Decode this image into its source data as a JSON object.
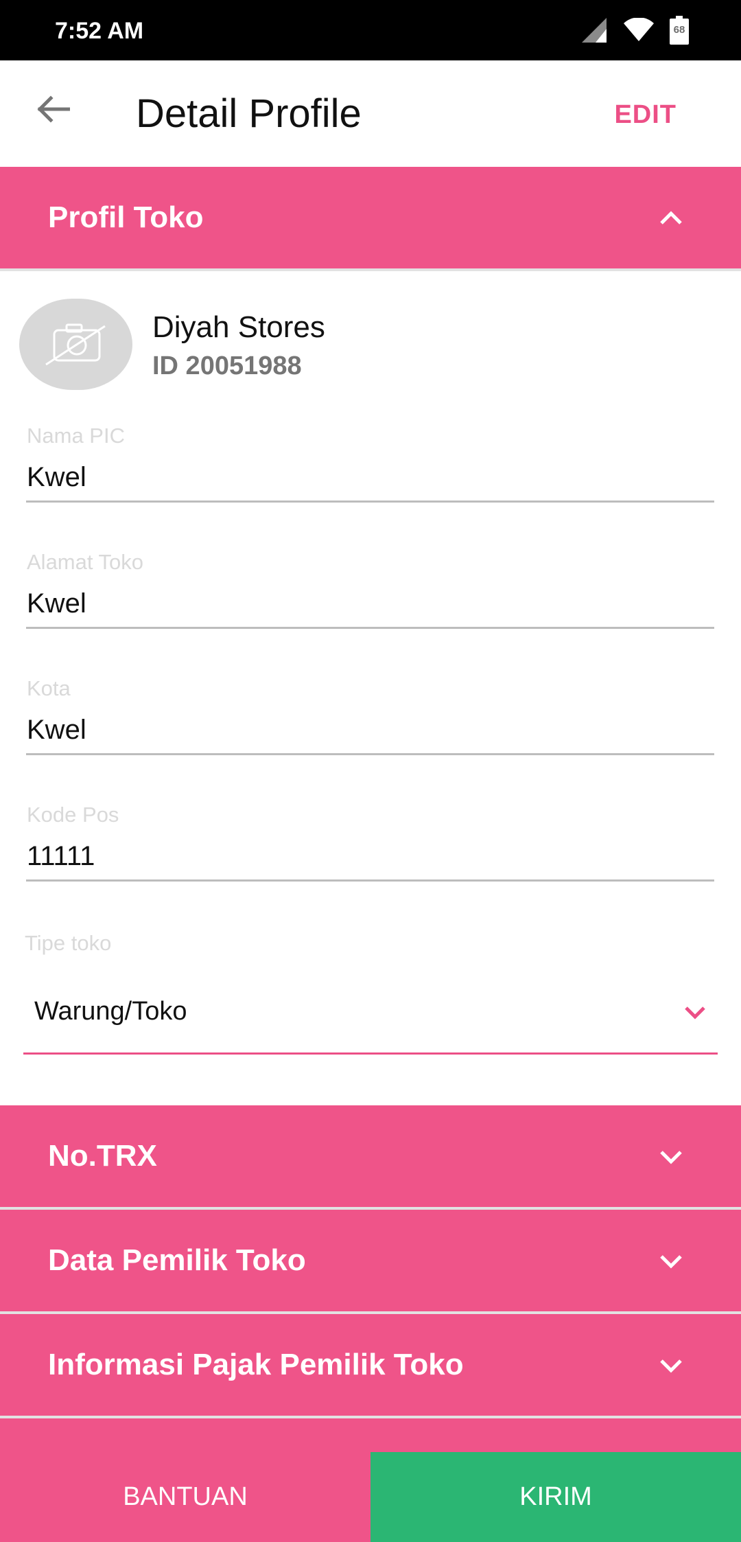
{
  "status_bar": {
    "time": "7:52 AM",
    "battery_level": "68",
    "icons": [
      "signal-icon",
      "wifi-icon",
      "battery-icon"
    ]
  },
  "app_bar": {
    "title": "Detail Profile",
    "edit_label": "EDIT",
    "back_icon": "arrow-left-icon"
  },
  "sections": {
    "profile": {
      "label": "Profil Toko",
      "expanded": true
    },
    "trx": {
      "label": "No.TRX",
      "expanded": false
    },
    "owner": {
      "label": "Data Pemilik Toko",
      "expanded": false
    },
    "tax": {
      "label": "Informasi Pajak Pemilik Toko",
      "expanded": false
    }
  },
  "store": {
    "name": "Diyah Stores",
    "id": "ID 20051988",
    "avatar_icon": "no-camera-icon"
  },
  "fields": {
    "pic": {
      "label": "Nama PIC",
      "value": "Kwel"
    },
    "address": {
      "label": "Alamat Toko",
      "value": "Kwel"
    },
    "city": {
      "label": "Kota",
      "value": "Kwel"
    },
    "postal": {
      "label": "Kode Pos",
      "value": "11111"
    }
  },
  "store_type": {
    "label": "Tipe toko",
    "selected": "Warung/Toko"
  },
  "bottom": {
    "help_label": "BANTUAN",
    "send_label": "KIRIM"
  },
  "colors": {
    "accent": "#ef5489",
    "accent_text": "#ec4f86",
    "send": "#2bb673"
  }
}
